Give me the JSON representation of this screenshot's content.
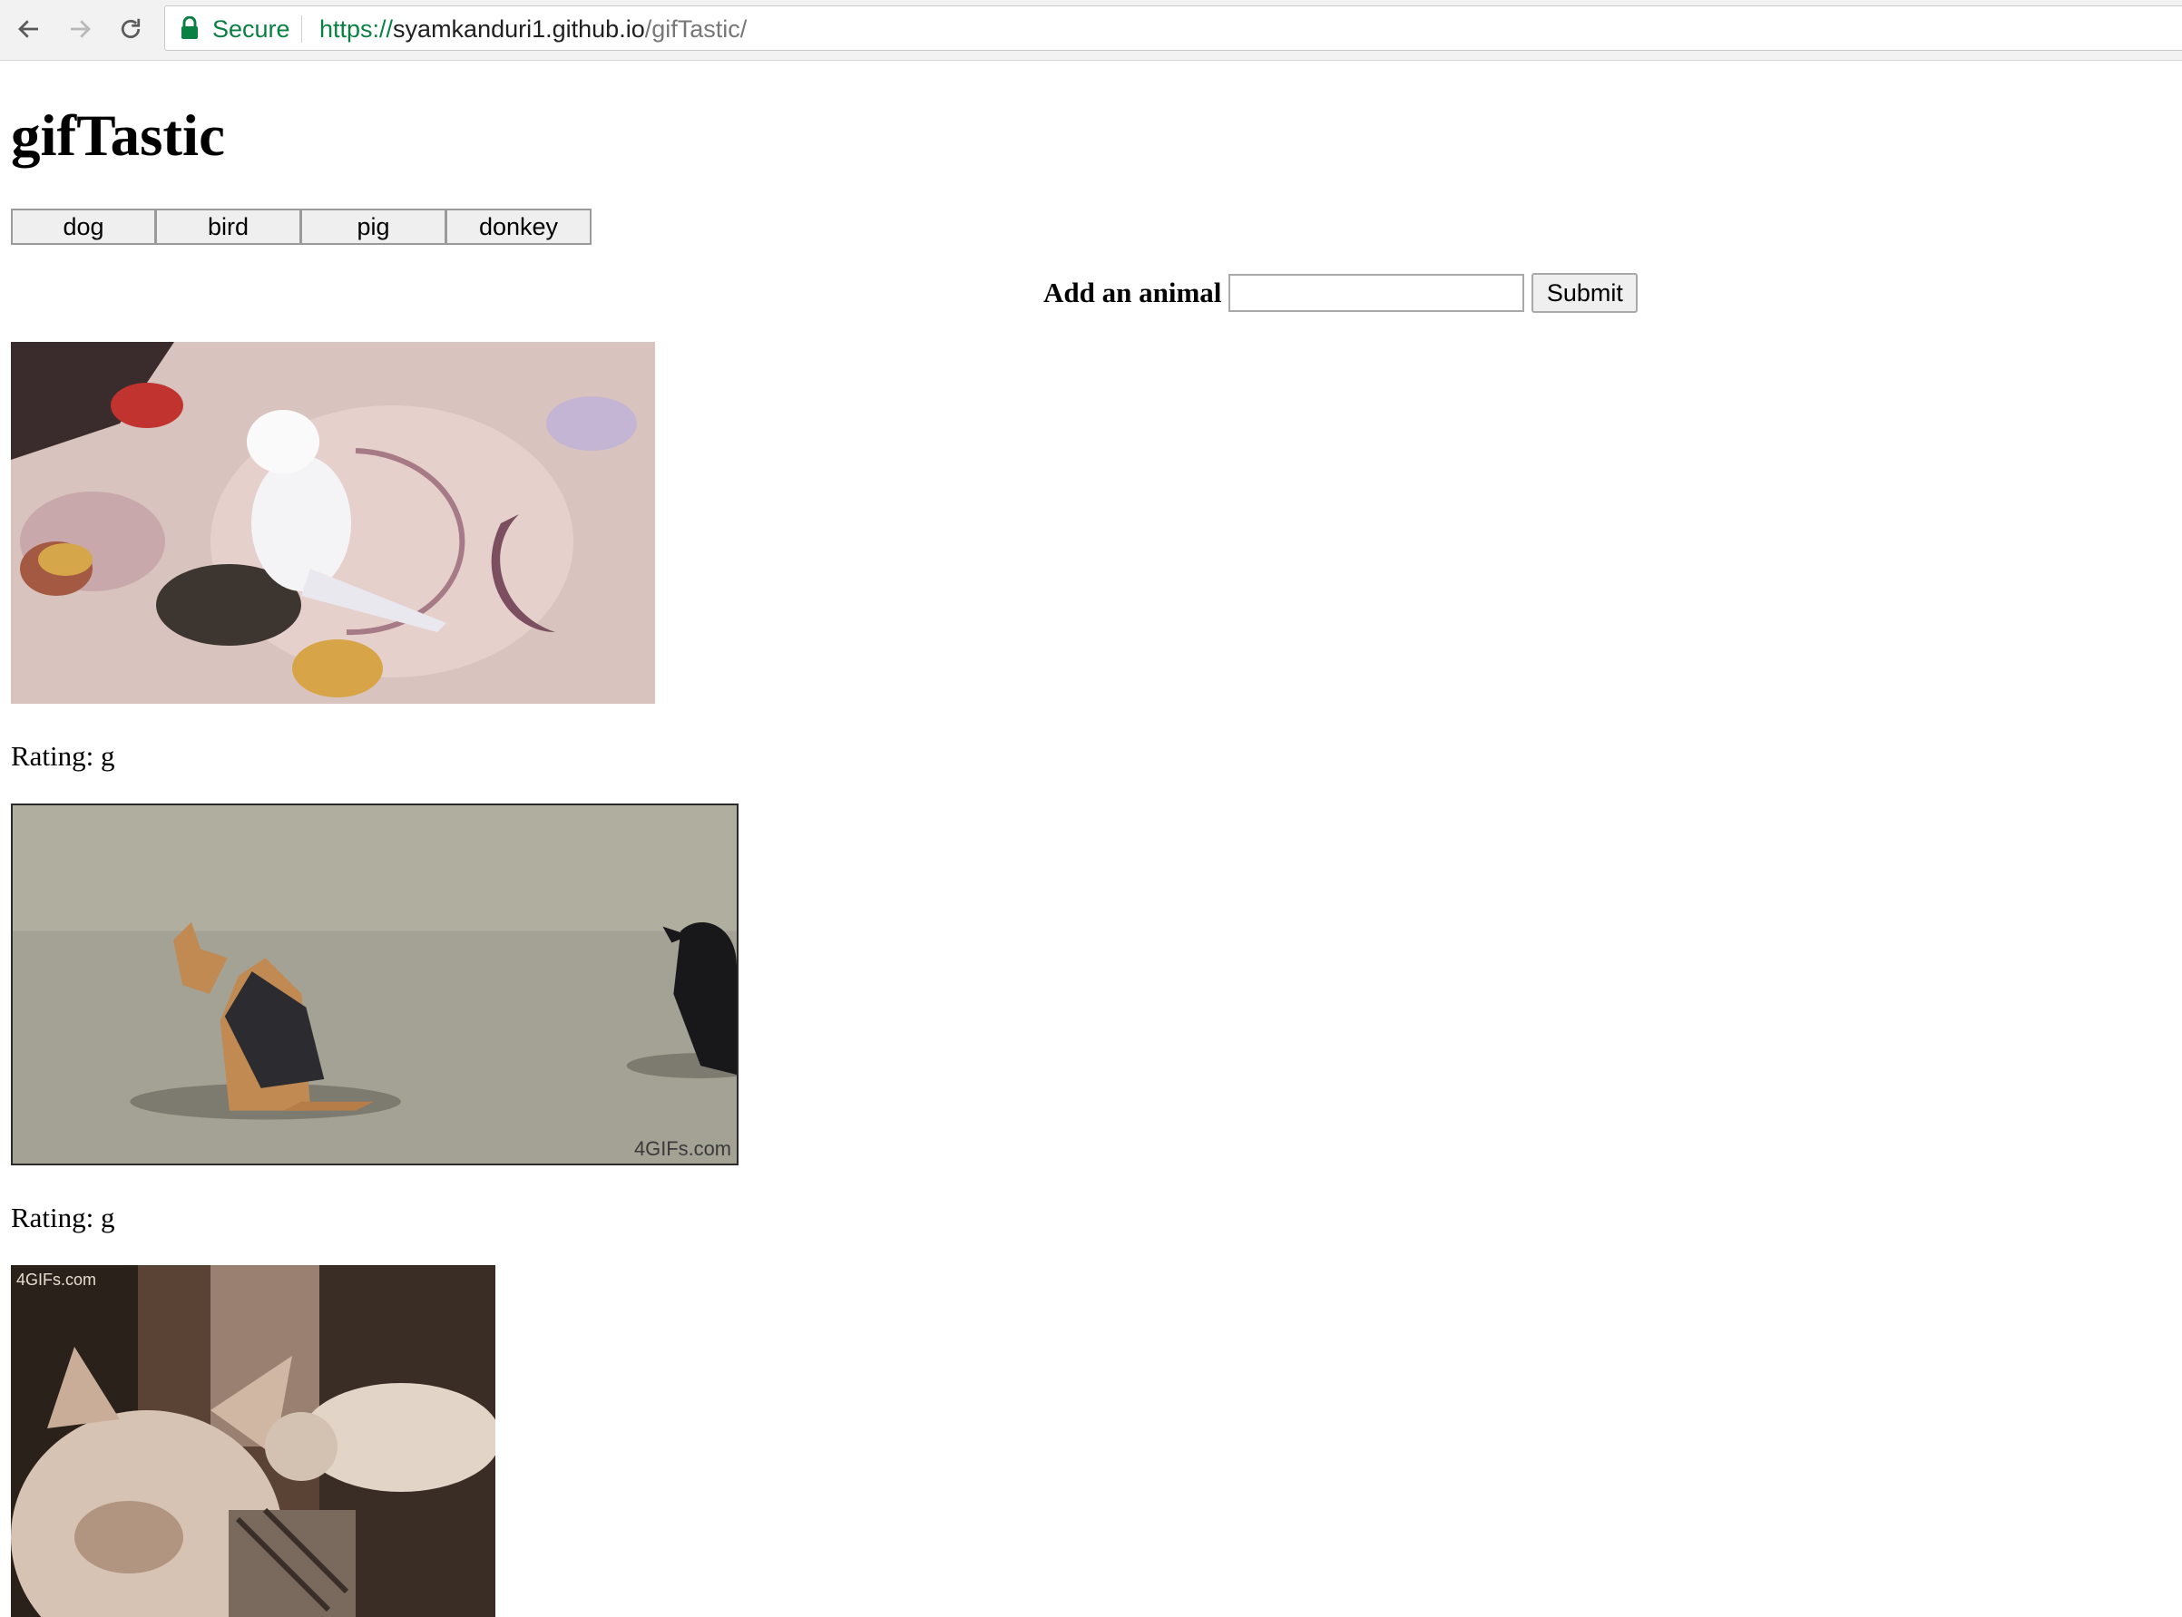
{
  "browser": {
    "secure_label": "Secure",
    "url_scheme": "https://",
    "url_host": "syamkanduri1.github.io",
    "url_path": "/gifTastic/"
  },
  "page": {
    "title": "gifTastic"
  },
  "animal_buttons": [
    "dog",
    "bird",
    "pig",
    "donkey"
  ],
  "add_form": {
    "label": "Add an animal",
    "input_value": "",
    "submit_label": "Submit"
  },
  "results": [
    {
      "image": "budgie-bird-gif",
      "rating_label": "Rating: g"
    },
    {
      "image": "dog-and-crow-gif",
      "rating_label": "Rating: g",
      "watermark": "4GIFs.com"
    },
    {
      "image": "cat-and-parakeet-gif",
      "watermark": "4GIFs.com"
    }
  ]
}
